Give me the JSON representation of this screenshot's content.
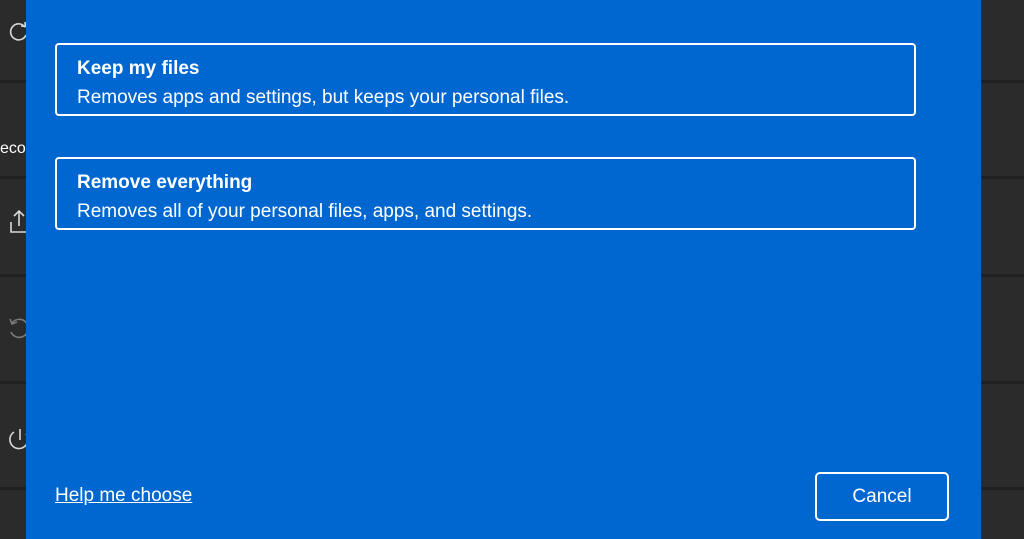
{
  "background": {
    "partial_label": "eco",
    "icons": [
      "sync-icon",
      "upload-recovery-icon",
      "go-back-icon",
      "power-restart-icon"
    ]
  },
  "dialog": {
    "options": [
      {
        "title": "Keep my files",
        "description": "Removes apps and settings, but keeps your personal files."
      },
      {
        "title": "Remove everything",
        "description": "Removes all of your personal files, apps, and settings."
      }
    ],
    "help_link": "Help me choose",
    "cancel_label": "Cancel"
  },
  "colors": {
    "dialog_background": "#0067d0",
    "app_background": "#202020",
    "text": "#ffffff"
  }
}
